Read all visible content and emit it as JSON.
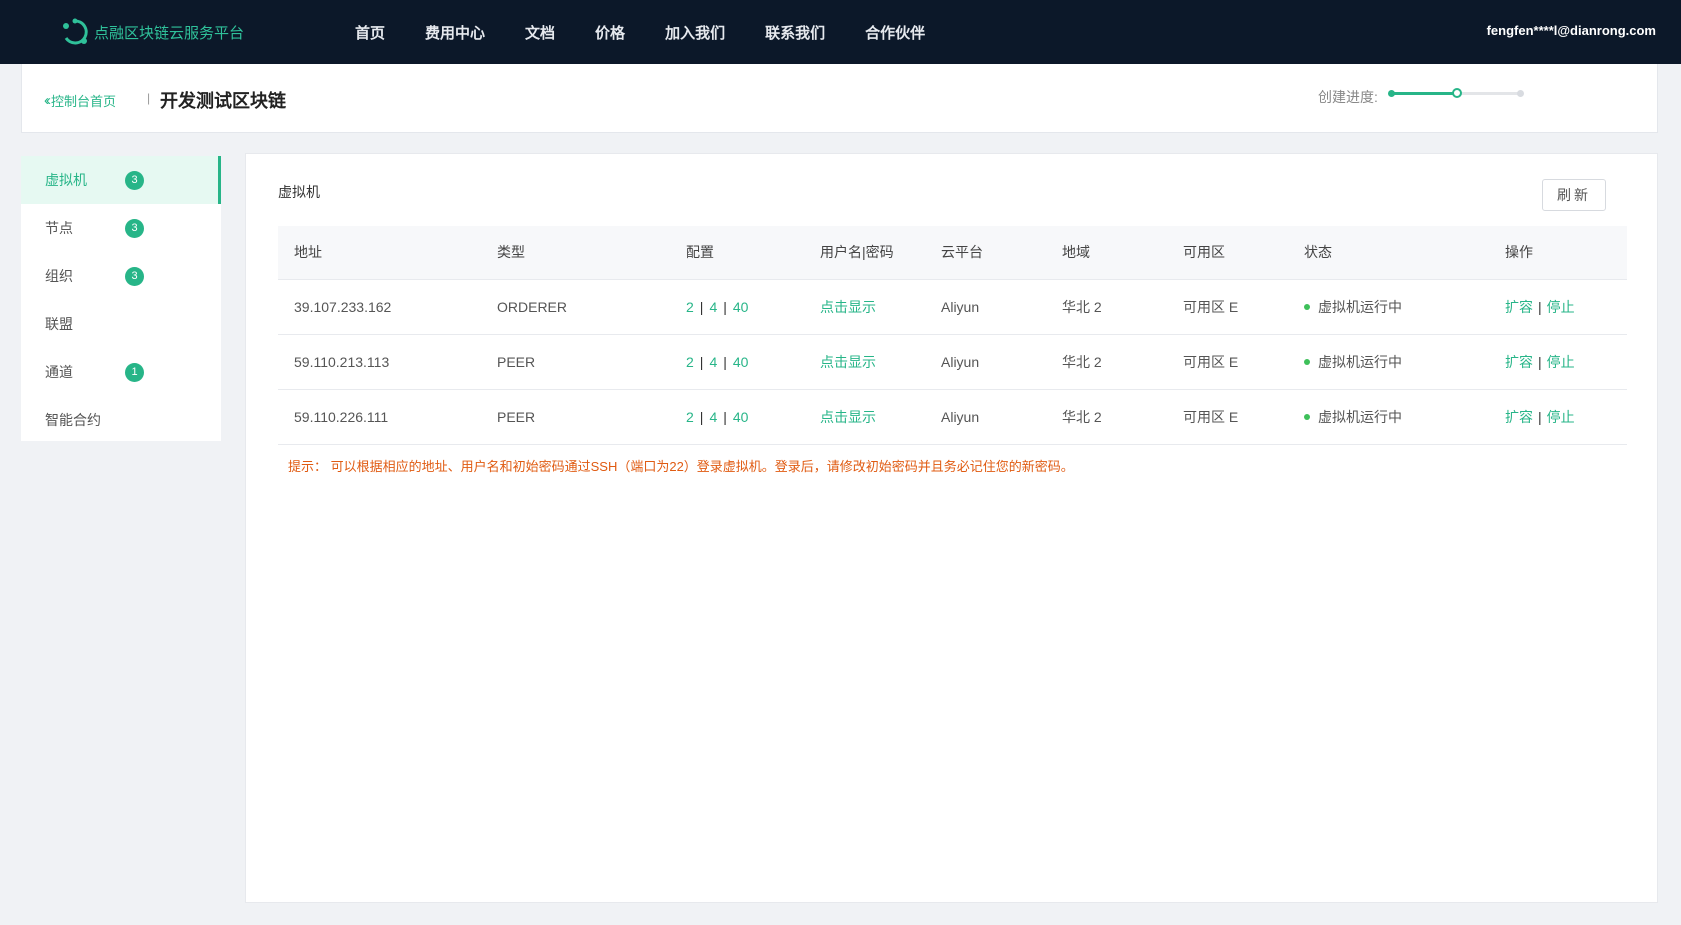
{
  "topbar": {
    "brand": "点融区块链云服务平台",
    "nav": [
      "首页",
      "费用中心",
      "文档",
      "价格",
      "加入我们",
      "联系我们",
      "合作伙伴"
    ],
    "user": "fengfen****l@dianrong.com",
    "brand_color": "#2fc19a",
    "bg_color": "#0c1829"
  },
  "header": {
    "back_label": "控制台首页",
    "title": "开发测试区块链",
    "progress_label": "创建进度:",
    "progress_fraction": 0.5
  },
  "sidebar": {
    "items": [
      {
        "label": "虚拟机",
        "badge": "3",
        "active": true
      },
      {
        "label": "节点",
        "badge": "3"
      },
      {
        "label": "组织",
        "badge": "3"
      },
      {
        "label": "联盟",
        "badge": ""
      },
      {
        "label": "通道",
        "badge": "1"
      },
      {
        "label": "智能合约",
        "badge": ""
      }
    ]
  },
  "main": {
    "title": "虚拟机",
    "refresh_label": "刷新",
    "columns": [
      "地址",
      "类型",
      "配置",
      "用户名|密码",
      "云平台",
      "地域",
      "可用区",
      "状态",
      "操作"
    ],
    "rows": [
      {
        "address": "39.107.233.162",
        "type": "ORDERER",
        "cpu": "2",
        "mem": "4",
        "disk": "40",
        "cred": "点击显示",
        "cloud": "Aliyun",
        "region": "华北 2",
        "zone": "可用区 E",
        "status": "虚拟机运行中",
        "op1": "扩容",
        "op2": "停止"
      },
      {
        "address": "59.110.213.113",
        "type": "PEER",
        "cpu": "2",
        "mem": "4",
        "disk": "40",
        "cred": "点击显示",
        "cloud": "Aliyun",
        "region": "华北 2",
        "zone": "可用区 E",
        "status": "虚拟机运行中",
        "op1": "扩容",
        "op2": "停止"
      },
      {
        "address": "59.110.226.111",
        "type": "PEER",
        "cpu": "2",
        "mem": "4",
        "disk": "40",
        "cred": "点击显示",
        "cloud": "Aliyun",
        "region": "华北 2",
        "zone": "可用区 E",
        "status": "虚拟机运行中",
        "op1": "扩容",
        "op2": "停止"
      }
    ],
    "hint": "提示： 可以根据相应的地址、用户名和初始密码通过SSH（端口为22）登录虚拟机。登录后，请修改初始密码并且务必记住您的新密码。"
  },
  "colors": {
    "accent": "#27b588",
    "hint": "#e05b12",
    "status": "#3ec05a"
  }
}
